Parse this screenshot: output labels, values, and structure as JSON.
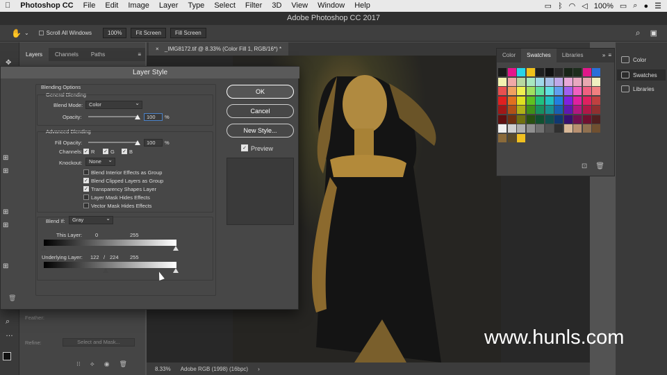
{
  "menubar": {
    "app": "Photoshop CC",
    "items": [
      "File",
      "Edit",
      "Image",
      "Layer",
      "Type",
      "Select",
      "Filter",
      "3D",
      "View",
      "Window",
      "Help"
    ],
    "battery": "100%"
  },
  "window_title": "Adobe Photoshop CC 2017",
  "options_bar": {
    "scroll_all_label": "Scroll All Windows",
    "zoom_button": "100%",
    "fit_screen": "Fit Screen",
    "fill_screen": "Fill Screen"
  },
  "left_panel": {
    "tabs": [
      "Layers",
      "Channels",
      "Paths"
    ],
    "feather_label": "Feather:",
    "refine_label": "Refine:",
    "select_mask_button": "Select and Mask..."
  },
  "doc_tab": "_IMG8172.tif @ 8.33% (Color Fill 1, RGB/16*) *",
  "status": {
    "zoom": "8.33%",
    "profile": "Adobe RGB (1998) (16bpc)"
  },
  "swatches_panel": {
    "tabs": [
      "Color",
      "Swatches",
      "Libraries"
    ],
    "colors": [
      "#1a1a1a",
      "#e4168c",
      "#28d4e8",
      "#f0c11a",
      "#1f1f1f",
      "#111111",
      "#2a2a2a",
      "#182418",
      "#1d2d1d",
      "#e0188a",
      "#2a6fd8",
      "#f3f3b0",
      "#f0a8a8",
      "#b8d8a0",
      "#a8e8c0",
      "#a0d8e8",
      "#a8c0e8",
      "#c0a8e8",
      "#e8a8d8",
      "#e8a8c0",
      "#e8a8b0",
      "#f0f0c0",
      "#e85050",
      "#f0a060",
      "#f0f050",
      "#a0e060",
      "#60e0a0",
      "#60e0e0",
      "#60a0f0",
      "#a060f0",
      "#f060c0",
      "#f06080",
      "#f08080",
      "#e02020",
      "#e07020",
      "#e0e020",
      "#60c020",
      "#20c080",
      "#20c0c0",
      "#2080e0",
      "#8020e0",
      "#e020a0",
      "#e02060",
      "#c04040",
      "#a01818",
      "#b05018",
      "#b0b018",
      "#409018",
      "#189060",
      "#189090",
      "#1860b0",
      "#6018b0",
      "#b01880",
      "#b01848",
      "#903030",
      "#601010",
      "#703010",
      "#707010",
      "#285010",
      "#105030",
      "#105050",
      "#103870",
      "#381070",
      "#701050",
      "#701030",
      "#502020",
      "#f0f0f0",
      "#d0d0d0",
      "#b0b0b0",
      "#909090",
      "#707070",
      "#505050",
      "#303030",
      "#d8b898",
      "#b89070",
      "#907050",
      "#705030",
      "#8a6a3a",
      "#5a4a2a",
      "#f0c020"
    ],
    "visible_rows_note": ""
  },
  "right_strip": {
    "items": [
      "Color",
      "Swatches",
      "Libraries"
    ]
  },
  "watermark": "www.hunls.com",
  "dialog": {
    "title": "Layer Style",
    "blending_options": "Blending Options",
    "general_blending": "General Blending",
    "blend_mode_label": "Blend Mode:",
    "blend_mode_value": "Color",
    "opacity_label": "Opacity:",
    "opacity_value": "100",
    "percent": "%",
    "advanced_blending": "Advanced Blending",
    "fill_opacity_label": "Fill Opacity:",
    "fill_opacity_value": "100",
    "channels_label": "Channels:",
    "ch_r": "R",
    "ch_g": "G",
    "ch_b": "B",
    "knockout_label": "Knockout:",
    "knockout_value": "None",
    "opt1": "Blend Interior Effects as Group",
    "opt2": "Blend Clipped Layers as Group",
    "opt3": "Transparency Shapes Layer",
    "opt4": "Layer Mask Hides Effects",
    "opt5": "Vector Mask Hides Effects",
    "blend_if_label": "Blend If:",
    "blend_if_value": "Gray",
    "this_layer_label": "This Layer:",
    "this_layer_min": "0",
    "this_layer_max": "255",
    "underlying_label": "Underlying Layer:",
    "underlying_a": "122",
    "underlying_slash": "/",
    "underlying_b": "224",
    "underlying_max": "255",
    "ok": "OK",
    "cancel": "Cancel",
    "new_style": "New Style...",
    "preview": "Preview"
  }
}
